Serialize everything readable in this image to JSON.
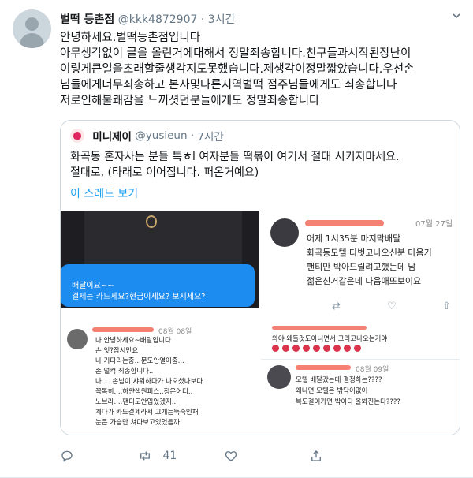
{
  "tweet": {
    "name": "벌떡 등촌점",
    "handle": "@kkk4872907",
    "dot": "·",
    "time": "3시간",
    "lines": [
      "안녕하세요.벌떡등촌점입니다",
      "아무생각없이 글을 올린거에대해서 정말죄송합니다.친구들과시작된장난이",
      "이렇게큰일을초래할줄생각지도못했습니다.제생각이정말짧았습니다.우선손",
      "님들에게너무죄송하고 본사및다른지역벌떡 점주님들에게도 죄송합니다",
      "저로인해불쾌감을 느끼셧던분들에게도 정말죄송합니다"
    ]
  },
  "quote": {
    "name": "미니제이",
    "handle": "@yusieun",
    "dot": "·",
    "time": "7시간",
    "lines": [
      "화곡동 혼자사는 분들 특ㅎl 여자분들 떡볶이 여기서 절대 시키지마세요.",
      "절대로, (타래로 이어집니다. 퍼온거예요)"
    ],
    "thread_link": "이 스레드 보기"
  },
  "screenshots": {
    "s1": {
      "line1": "배달이요~~",
      "line2": "결제는 카드세요?현금이세요? 보지세요?"
    },
    "s2": {
      "date": "07월 27일",
      "lines": [
        "어제 1시35분 마지막배달",
        "화곡동모텔 다벗고나오신분 마음기",
        "팬티만 박아드릴려고했는데 남",
        "젊은신거같은데 다음애또보이요"
      ]
    },
    "s3": {
      "date": "08월 08일",
      "lines": [
        "나 안녕하세요~배달입니다",
        "손 엇?잠시만요",
        "나 기다리는중...문도안열어줌...",
        "손 덜컥 죄송합니다..",
        "나 ....손님이 샤워하다가 나오셨나보다",
        "   꼭톡히....하얀색원피스..정은어디..",
        "   노브라....팬티도안입었겠지..",
        "   계다가 카드결제라서 고개는뚝숙인채",
        "   눈은 가슴만 쳐다보고있었음까"
      ]
    },
    "s4": {
      "top_line": "와야 왜들것도아니면서 그러고나오는거야",
      "date": "08월 09일",
      "lines": [
        "모텔 배달갔는데 결정하는????",
        "왜나면 모텔은 밖닥이없어",
        "복도걸어가면 박아다 올봐진는다????"
      ]
    }
  },
  "actions": {
    "retweets": "41"
  },
  "colors": {
    "link": "#1da1f2",
    "secondary_text": "#657786",
    "border": "#ccd6dd",
    "redaction": "#f26b5b"
  },
  "icons": [
    "avatar-placeholder",
    "chevron-down-icon",
    "reply-icon",
    "retweet-icon",
    "like-icon",
    "share-icon"
  ]
}
